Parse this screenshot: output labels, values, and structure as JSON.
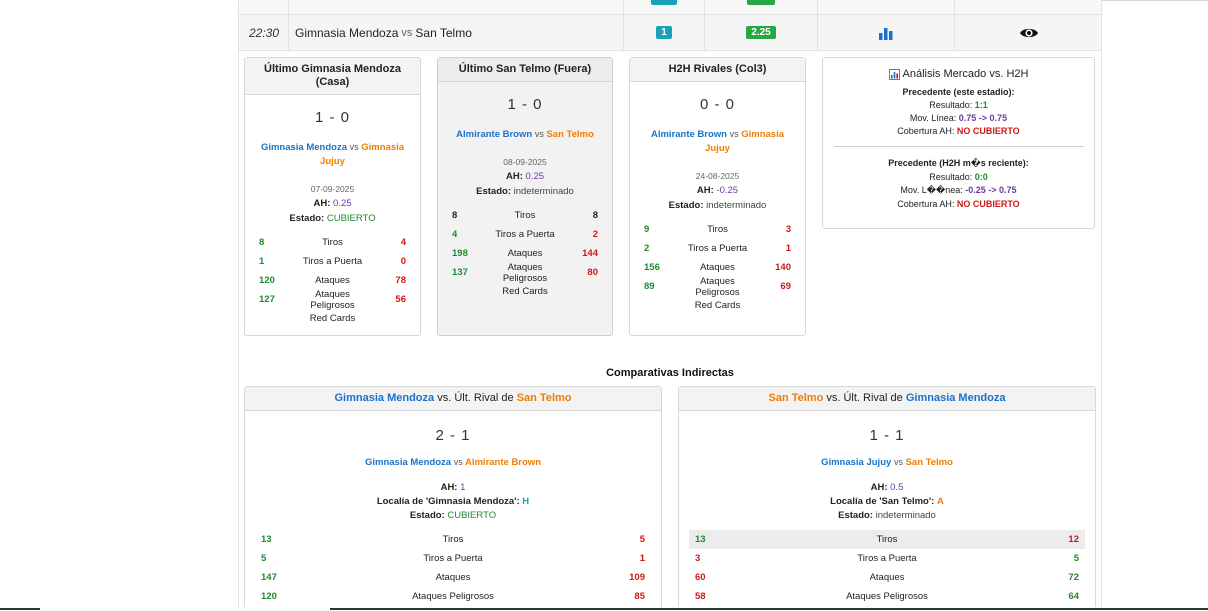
{
  "match_row": {
    "time": "22:30",
    "home": "Gimnasia Mendoza",
    "vs": "vs",
    "away": "San Telmo",
    "ah_badge": "1",
    "goals_badge": "2.25",
    "chart_icon": "bar-chart-icon",
    "view_icon": "eye-icon"
  },
  "colors": {
    "team_home": "#1a73c8",
    "team_away": "#f07d00",
    "positive": "#1f8a2e",
    "negative": "#d01818",
    "ah": "#6a3aa5",
    "badge_teal": "#17a2b8",
    "badge_green": "#28a745"
  },
  "cards": [
    {
      "title": "Último Gimnasia Mendoza (Casa)",
      "score": "1 - 0",
      "team_a": "Gimnasia Mendoza",
      "vs": "vs",
      "team_b": "Gimnasia Jujuy",
      "date": "07-09-2025",
      "ah_label": "AH:",
      "ah": "0.25",
      "status_label": "Estado:",
      "status": "CUBIERTO",
      "stats": [
        {
          "l": "8",
          "name": "Tiros",
          "r": "4"
        },
        {
          "l": "1",
          "name": "Tiros a Puerta",
          "r": "0"
        },
        {
          "l": "120",
          "name": "Ataques",
          "r": "78"
        },
        {
          "l": "127",
          "name": "Ataques Peligrosos",
          "r": "56"
        }
      ],
      "red_cards": "Red Cards"
    },
    {
      "title": "Último San Telmo (Fuera)",
      "score": "1 - 0",
      "team_a": "Almirante Brown",
      "vs": "vs",
      "team_b": "San Telmo",
      "date": "08-09-2025",
      "ah_label": "AH:",
      "ah": "0.25",
      "status_label": "Estado:",
      "status": "indeterminado",
      "stats": [
        {
          "l": "8",
          "name": "Tiros",
          "r": "8"
        },
        {
          "l": "4",
          "name": "Tiros a Puerta",
          "r": "2"
        },
        {
          "l": "198",
          "name": "Ataques",
          "r": "144"
        },
        {
          "l": "137",
          "name": "Ataques Peligrosos",
          "r": "80"
        }
      ],
      "red_cards": "Red Cards"
    },
    {
      "title": "H2H Rivales (Col3)",
      "score": "0 - 0",
      "team_a": "Almirante Brown",
      "vs": "vs",
      "team_b": "Gimnasia Jujuy",
      "date": "24-08-2025",
      "ah_label": "AH:",
      "ah": "-0.25",
      "status_label": "Estado:",
      "status": "indeterminado",
      "stats": [
        {
          "l": "9",
          "name": "Tiros",
          "r": "3"
        },
        {
          "l": "2",
          "name": "Tiros a Puerta",
          "r": "1"
        },
        {
          "l": "156",
          "name": "Ataques",
          "r": "140"
        },
        {
          "l": "89",
          "name": "Ataques Peligrosos",
          "r": "69"
        }
      ],
      "red_cards": "Red Cards"
    }
  ],
  "analysis": {
    "title": "Análisis Mercado vs. H2H",
    "p1_title": "Precedente (este estadio):",
    "p1_result_label": "Resultado:",
    "p1_result": "1:1",
    "p1_move_label": "Mov. Línea:",
    "p1_move": "0.75 -> 0.75",
    "p1_cov_label": "Cobertura AH:",
    "p1_cov": "NO CUBIERTO",
    "p2_title": "Precedente (H2H m�s reciente):",
    "p2_result_label": "Resultado:",
    "p2_result": "0:0",
    "p2_move_label": "Mov. L��nea:",
    "p2_move": "-0.25 -> 0.75",
    "p2_cov_label": "Cobertura AH:",
    "p2_cov": "NO CUBIERTO"
  },
  "indirect": {
    "section_title": "Comparativas Indirectas",
    "panels": [
      {
        "head_team_a": "Gimnasia Mendoza",
        "head_mid": "vs. Últ. Rival de",
        "head_team_b": "San Telmo",
        "score": "2 - 1",
        "team_a": "Gimnasia Mendoza",
        "vs": "vs",
        "team_b": "Almirante Brown",
        "ah_label": "AH:",
        "ah": "1",
        "locality_label": "Localía de 'Gimnasia Mendoza':",
        "locality": "H",
        "status_label": "Estado:",
        "status": "CUBIERTO",
        "stats": [
          {
            "l": "13",
            "name": "Tiros",
            "r": "5"
          },
          {
            "l": "5",
            "name": "Tiros a Puerta",
            "r": "1"
          },
          {
            "l": "147",
            "name": "Ataques",
            "r": "109"
          },
          {
            "l": "120",
            "name": "Ataques Peligrosos",
            "r": "85"
          }
        ]
      },
      {
        "head_team_a": "San Telmo",
        "head_mid": "vs. Últ. Rival de",
        "head_team_b": "Gimnasia Mendoza",
        "score": "1 - 1",
        "team_a": "Gimnasia Jujuy",
        "vs": "vs",
        "team_b": "San Telmo",
        "ah_label": "AH:",
        "ah": "0.5",
        "locality_label": "Localía de 'San Telmo':",
        "locality": "A",
        "status_label": "Estado:",
        "status": "indeterminado",
        "stats": [
          {
            "l": "13",
            "name": "Tiros",
            "r": "12"
          },
          {
            "l": "3",
            "name": "Tiros a Puerta",
            "r": "5"
          },
          {
            "l": "60",
            "name": "Ataques",
            "r": "72"
          },
          {
            "l": "58",
            "name": "Ataques Peligrosos",
            "r": "64"
          }
        ]
      }
    ]
  }
}
